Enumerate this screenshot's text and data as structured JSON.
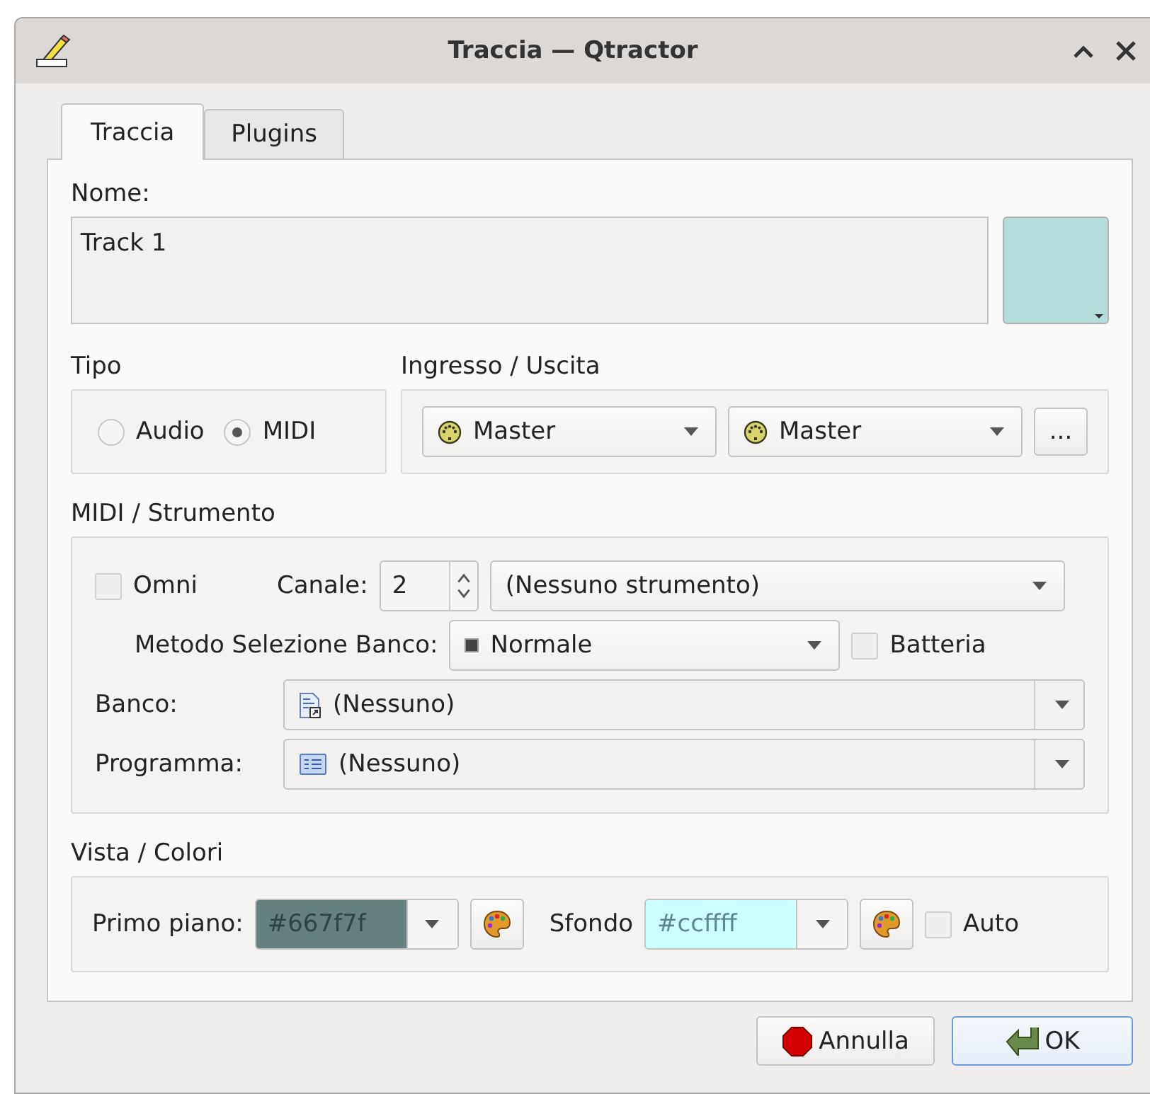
{
  "window": {
    "title": "Traccia — Qtractor"
  },
  "tabs": [
    {
      "label": "Traccia",
      "selected": true
    },
    {
      "label": "Plugins",
      "selected": false
    }
  ],
  "name": {
    "label": "Nome:",
    "value": "Track 1",
    "color": "#b7dcdc"
  },
  "type": {
    "title": "Tipo",
    "options": [
      {
        "label": "Audio",
        "selected": false
      },
      {
        "label": "MIDI",
        "selected": true
      }
    ]
  },
  "io": {
    "title": "Ingresso / Uscita",
    "input": "Master",
    "output": "Master",
    "more_button": "..."
  },
  "midi": {
    "title": "MIDI / Strumento",
    "omni": {
      "label": "Omni",
      "checked": false
    },
    "channel_label": "Canale:",
    "channel": "2",
    "instrument": "(Nessuno strumento)",
    "bank_method_label": "Metodo Selezione Banco:",
    "bank_method": "Normale",
    "drums": {
      "label": "Batteria",
      "checked": false
    },
    "bank_label": "Banco:",
    "bank": "(Nessuno)",
    "program_label": "Programma:",
    "program": "(Nessuno)"
  },
  "view": {
    "title": "Vista / Colori",
    "foreground_label": "Primo piano:",
    "foreground": {
      "value": "#667f7f",
      "color": "#667f7f"
    },
    "background_label": "Sfondo",
    "background": {
      "value": "#ccffff",
      "color": "#ccffff"
    },
    "auto": {
      "label": "Auto",
      "checked": false
    }
  },
  "buttons": [
    {
      "label": "Annulla",
      "kind": "cancel"
    },
    {
      "label": "OK",
      "kind": "ok"
    }
  ]
}
